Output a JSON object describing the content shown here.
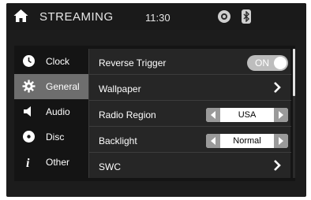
{
  "header": {
    "title": "STREAMING",
    "time": "11:30",
    "icons": [
      "home-icon",
      "settings-status-icon",
      "bluetooth-icon"
    ]
  },
  "sidebar": {
    "items": [
      {
        "label": "Clock",
        "icon": "clock-icon"
      },
      {
        "label": "General",
        "icon": "gear-icon",
        "active": true
      },
      {
        "label": "Audio",
        "icon": "speaker-icon"
      },
      {
        "label": "Disc",
        "icon": "disc-icon"
      },
      {
        "label": "Other",
        "icon": "info-icon"
      }
    ]
  },
  "settings": {
    "rows": [
      {
        "label": "Reverse Trigger",
        "control": "toggle",
        "value": "ON"
      },
      {
        "label": "Wallpaper",
        "control": "chevron"
      },
      {
        "label": "Radio Region",
        "control": "selector",
        "value": "USA"
      },
      {
        "label": "Backlight",
        "control": "selector",
        "value": "Normal"
      },
      {
        "label": "SWC",
        "control": "chevron"
      }
    ]
  },
  "colors": {
    "background": "#1c1c1c",
    "active_item": "#6e6e6e",
    "toggle_on": "#bdbdbd"
  }
}
